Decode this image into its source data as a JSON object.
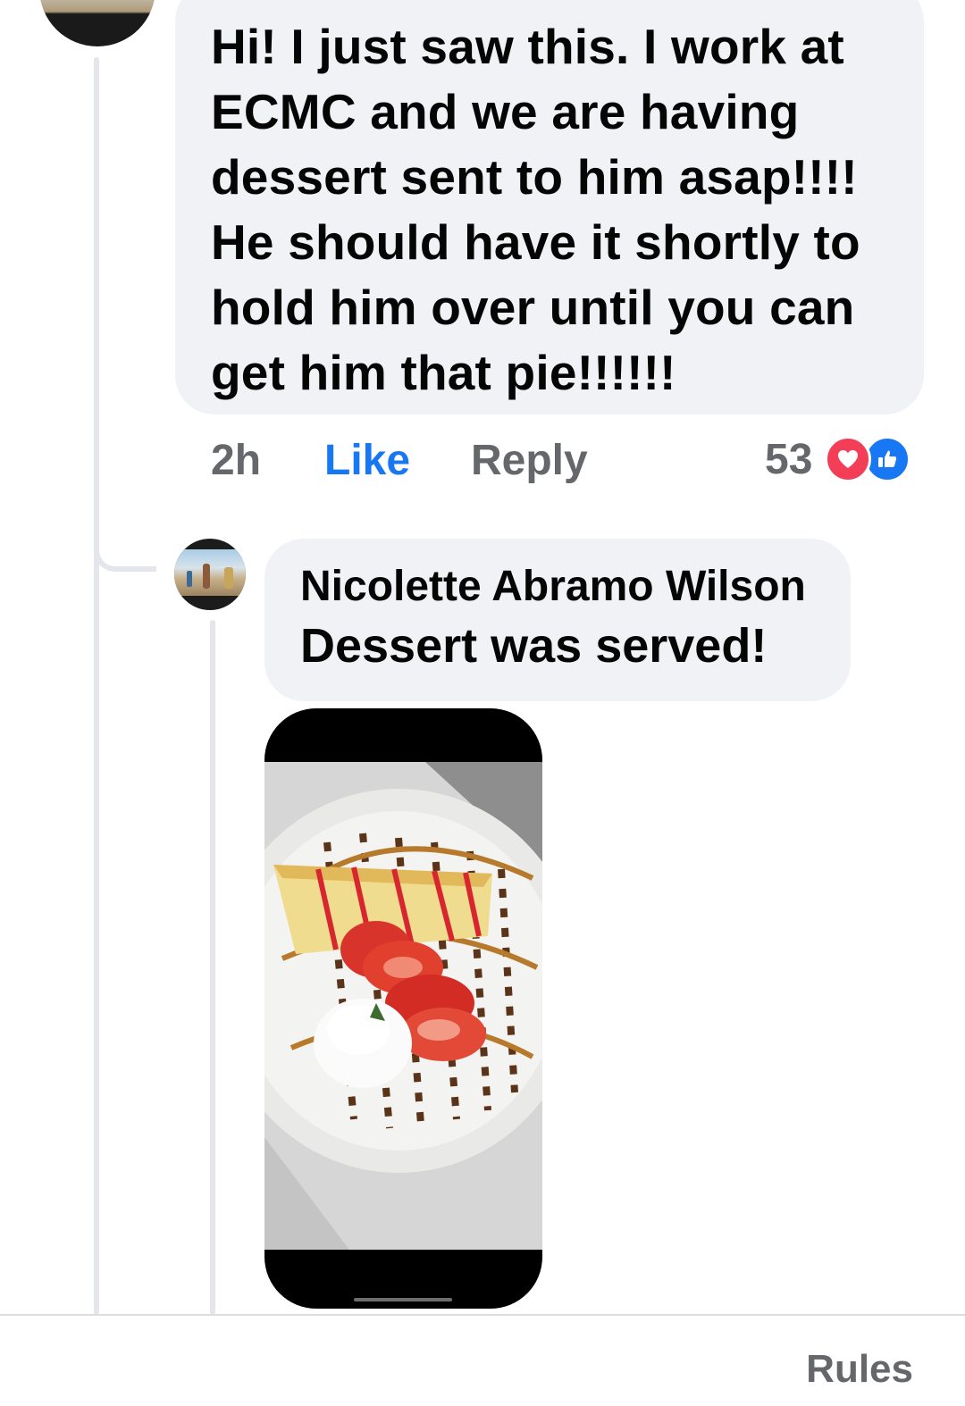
{
  "main_comment": {
    "text": "Hi! I just saw this. I work at\nECMC and we are having\ndessert sent to him asap!!!!\nHe should have it shortly to\nhold him over until you can\nget him that pie!!!!!!",
    "time": "2h",
    "like_label": "Like",
    "reply_label": "Reply",
    "reaction_count": "53",
    "reaction_icons": [
      "love-icon",
      "like-thumb-icon"
    ]
  },
  "reply_comment": {
    "author": "Nicolette Abramo Wilson",
    "text": "Dessert was served!",
    "attachment": "photo-of-dessert"
  },
  "footer": {
    "rules_label": "Rules"
  },
  "colors": {
    "bubble_bg": "#f0f2f5",
    "like_blue": "#1877f2",
    "love_red": "#f33e58",
    "meta_gray": "#65676b"
  }
}
